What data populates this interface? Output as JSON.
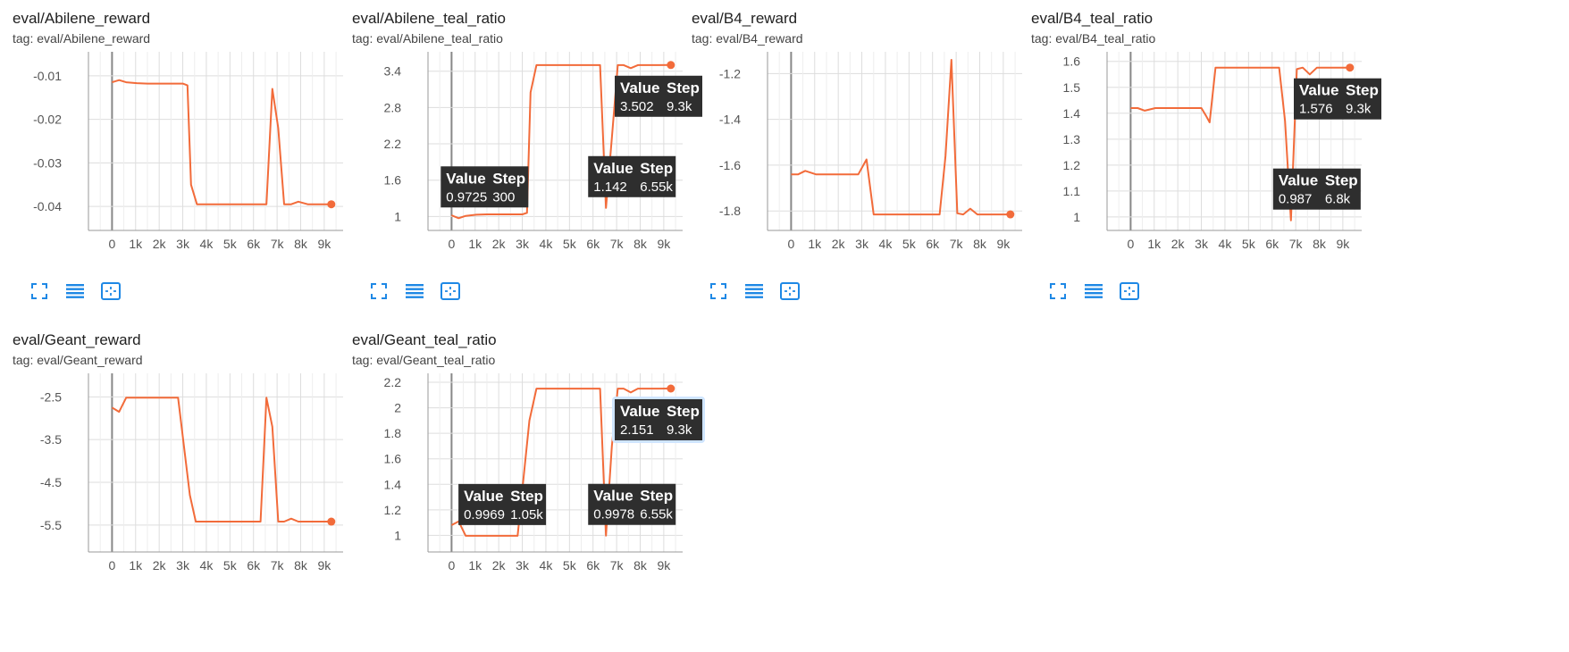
{
  "colors": {
    "line": "#f26b3a",
    "axis": "#999999",
    "grid": "#dddddd",
    "tooltip_bg": "#2e2e2e",
    "tooltip_text": "#ffffff",
    "tool_icon": "#1e88e5"
  },
  "tooltip_labels": {
    "value": "Value",
    "step": "Step"
  },
  "toolbar_icons": [
    "expand-icon",
    "data-table-icon",
    "fit-domain-icon"
  ],
  "cards": [
    {
      "title": "eval/Abilene_reward",
      "tag": "tag: eval/Abilene_reward"
    },
    {
      "title": "eval/Abilene_teal_ratio",
      "tag": "tag: eval/Abilene_teal_ratio"
    },
    {
      "title": "eval/B4_reward",
      "tag": "tag: eval/B4_reward"
    },
    {
      "title": "eval/B4_teal_ratio",
      "tag": "tag: eval/B4_teal_ratio"
    },
    {
      "title": "eval/Geant_reward",
      "tag": "tag: eval/Geant_reward"
    },
    {
      "title": "eval/Geant_teal_ratio",
      "tag": "tag: eval/Geant_teal_ratio"
    }
  ],
  "chart_data": [
    {
      "type": "line",
      "xlim": [
        -1000,
        9800
      ],
      "ylim": [
        -0.0455,
        -0.0045
      ],
      "xticks": [
        0,
        1000,
        2000,
        3000,
        4000,
        5000,
        6000,
        7000,
        8000,
        9000
      ],
      "xtick_labels": [
        "0",
        "1k",
        "2k",
        "3k",
        "4k",
        "5k",
        "6k",
        "7k",
        "8k",
        "9k"
      ],
      "yticks": [
        -0.01,
        -0.02,
        -0.03,
        -0.04
      ],
      "ytick_labels": [
        "-0.01",
        "-0.02",
        "-0.03",
        "-0.04"
      ],
      "x": [
        0,
        300,
        600,
        1050,
        1500,
        2000,
        2500,
        3000,
        3200,
        3350,
        3600,
        4000,
        5000,
        6000,
        6550,
        6800,
        7050,
        7300,
        7600,
        7900,
        8300,
        8800,
        9300
      ],
      "y": [
        -0.0115,
        -0.011,
        -0.0115,
        -0.0117,
        -0.0118,
        -0.0118,
        -0.0118,
        -0.0118,
        -0.0122,
        -0.035,
        -0.0395,
        -0.0395,
        -0.0395,
        -0.0395,
        -0.0395,
        -0.013,
        -0.022,
        -0.0395,
        -0.0395,
        -0.0389,
        -0.0395,
        -0.0395,
        -0.0395
      ],
      "tooltips": []
    },
    {
      "type": "line",
      "xlim": [
        -1000,
        9800
      ],
      "ylim": [
        0.77,
        3.72
      ],
      "xticks": [
        0,
        1000,
        2000,
        3000,
        4000,
        5000,
        6000,
        7000,
        8000,
        9000
      ],
      "xtick_labels": [
        "0",
        "1k",
        "2k",
        "3k",
        "4k",
        "5k",
        "6k",
        "7k",
        "8k",
        "9k"
      ],
      "yticks": [
        1,
        1.6,
        2.2,
        2.8,
        3.4
      ],
      "ytick_labels": [
        "1",
        "1.6",
        "2.2",
        "2.8",
        "3.4"
      ],
      "x": [
        0,
        300,
        600,
        1050,
        1500,
        2000,
        2500,
        3000,
        3200,
        3350,
        3600,
        4000,
        5000,
        6000,
        6300,
        6550,
        6800,
        7050,
        7300,
        7600,
        7900,
        8300,
        8800,
        9300
      ],
      "y": [
        1.02,
        0.9725,
        1.01,
        1.03,
        1.035,
        1.035,
        1.035,
        1.035,
        1.06,
        3.05,
        3.5,
        3.5,
        3.5,
        3.5,
        3.5,
        1.142,
        2.3,
        3.5,
        3.5,
        3.45,
        3.5,
        3.5,
        3.5,
        3.502
      ],
      "tooltips": [
        {
          "value": "0.9725",
          "step": "300",
          "at_x": 300,
          "at_y": 0.9725
        },
        {
          "value": "1.142",
          "step": "6.55k",
          "at_x": 6550,
          "at_y": 1.142
        },
        {
          "value": "3.502",
          "step": "9.3k",
          "at_x": 9300,
          "at_y": 3.502
        }
      ]
    },
    {
      "type": "line",
      "xlim": [
        -1000,
        9800
      ],
      "ylim": [
        -1.885,
        -1.105
      ],
      "xticks": [
        0,
        1000,
        2000,
        3000,
        4000,
        5000,
        6000,
        7000,
        8000,
        9000
      ],
      "xtick_labels": [
        "0",
        "1k",
        "2k",
        "3k",
        "4k",
        "5k",
        "6k",
        "7k",
        "8k",
        "9k"
      ],
      "yticks": [
        -1.2,
        -1.4,
        -1.6,
        -1.8
      ],
      "ytick_labels": [
        "-1.2",
        "-1.4",
        "-1.6",
        "-1.8"
      ],
      "x": [
        0,
        300,
        600,
        1050,
        1500,
        2000,
        2500,
        2850,
        3200,
        3500,
        4000,
        5000,
        6000,
        6300,
        6550,
        6800,
        7050,
        7300,
        7600,
        7900,
        8300,
        8800,
        9300
      ],
      "y": [
        -1.64,
        -1.64,
        -1.625,
        -1.64,
        -1.64,
        -1.64,
        -1.64,
        -1.64,
        -1.575,
        -1.815,
        -1.815,
        -1.815,
        -1.815,
        -1.815,
        -1.56,
        -1.14,
        -1.81,
        -1.815,
        -1.79,
        -1.815,
        -1.815,
        -1.815,
        -1.815
      ],
      "tooltips": []
    },
    {
      "type": "line",
      "xlim": [
        -1000,
        9800
      ],
      "ylim": [
        0.948,
        1.637
      ],
      "xticks": [
        0,
        1000,
        2000,
        3000,
        4000,
        5000,
        6000,
        7000,
        8000,
        9000
      ],
      "xtick_labels": [
        "0",
        "1k",
        "2k",
        "3k",
        "4k",
        "5k",
        "6k",
        "7k",
        "8k",
        "9k"
      ],
      "yticks": [
        1,
        1.1,
        1.2,
        1.3,
        1.4,
        1.5,
        1.6
      ],
      "ytick_labels": [
        "1",
        "1.1",
        "1.2",
        "1.3",
        "1.4",
        "1.5",
        "1.6"
      ],
      "x": [
        0,
        300,
        600,
        1050,
        1500,
        2000,
        2500,
        3000,
        3200,
        3350,
        3600,
        4000,
        5000,
        6000,
        6300,
        6550,
        6800,
        7050,
        7300,
        7600,
        7900,
        8300,
        8800,
        9300
      ],
      "y": [
        1.42,
        1.42,
        1.41,
        1.42,
        1.42,
        1.42,
        1.42,
        1.42,
        1.39,
        1.365,
        1.576,
        1.576,
        1.576,
        1.576,
        1.576,
        1.37,
        0.987,
        1.57,
        1.576,
        1.55,
        1.576,
        1.576,
        1.576,
        1.576
      ],
      "tooltips": [
        {
          "value": "0.987",
          "step": "6.8k",
          "at_x": 6800,
          "at_y": 0.987
        },
        {
          "value": "1.576",
          "step": "9.3k",
          "at_x": 9300,
          "at_y": 1.576
        }
      ]
    },
    {
      "type": "line",
      "xlim": [
        -1000,
        9800
      ],
      "ylim": [
        -6.13,
        -1.95
      ],
      "xticks": [
        0,
        1000,
        2000,
        3000,
        4000,
        5000,
        6000,
        7000,
        8000,
        9000
      ],
      "xtick_labels": [
        "0",
        "1k",
        "2k",
        "3k",
        "4k",
        "5k",
        "6k",
        "7k",
        "8k",
        "9k"
      ],
      "yticks": [
        -2.5,
        -3.5,
        -4.5,
        -5.5
      ],
      "ytick_labels": [
        "-2.5",
        "-3.5",
        "-4.5",
        "-5.5"
      ],
      "x": [
        0,
        300,
        600,
        1050,
        1500,
        2000,
        2500,
        2800,
        3300,
        3550,
        4000,
        5000,
        6000,
        6300,
        6550,
        6800,
        7050,
        7300,
        7600,
        7900,
        8300,
        8800,
        9300
      ],
      "y": [
        -2.75,
        -2.85,
        -2.52,
        -2.52,
        -2.52,
        -2.52,
        -2.52,
        -2.52,
        -4.8,
        -5.42,
        -5.42,
        -5.42,
        -5.42,
        -5.42,
        -2.52,
        -3.2,
        -5.42,
        -5.42,
        -5.35,
        -5.42,
        -5.42,
        -5.42,
        -5.42
      ],
      "tooltips": []
    },
    {
      "type": "line",
      "xlim": [
        -1000,
        9800
      ],
      "ylim": [
        0.87,
        2.27
      ],
      "xticks": [
        0,
        1000,
        2000,
        3000,
        4000,
        5000,
        6000,
        7000,
        8000,
        9000
      ],
      "xtick_labels": [
        "0",
        "1k",
        "2k",
        "3k",
        "4k",
        "5k",
        "6k",
        "7k",
        "8k",
        "9k"
      ],
      "yticks": [
        1,
        1.2,
        1.4,
        1.6,
        1.8,
        2,
        2.2
      ],
      "ytick_labels": [
        "1",
        "1.2",
        "1.4",
        "1.6",
        "1.8",
        "2",
        "2.2"
      ],
      "x": [
        0,
        300,
        600,
        1050,
        1500,
        2000,
        2500,
        2800,
        3300,
        3600,
        4000,
        5000,
        6000,
        6300,
        6550,
        6800,
        7050,
        7300,
        7600,
        7900,
        8300,
        8800,
        9300
      ],
      "y": [
        1.08,
        1.11,
        0.9969,
        0.9969,
        0.997,
        0.997,
        0.997,
        0.997,
        1.9,
        2.15,
        2.15,
        2.15,
        2.15,
        2.15,
        0.9978,
        1.7,
        2.15,
        2.15,
        2.12,
        2.15,
        2.15,
        2.15,
        2.151
      ],
      "tooltips": [
        {
          "value": "0.9969",
          "step": "1.05k",
          "at_x": 1050,
          "at_y": 0.9969
        },
        {
          "value": "0.9978",
          "step": "6.55k",
          "at_x": 6550,
          "at_y": 0.9978
        },
        {
          "value": "2.151",
          "step": "9.3k",
          "at_x": 9300,
          "at_y": 2.151,
          "highlighted": true
        }
      ]
    }
  ]
}
